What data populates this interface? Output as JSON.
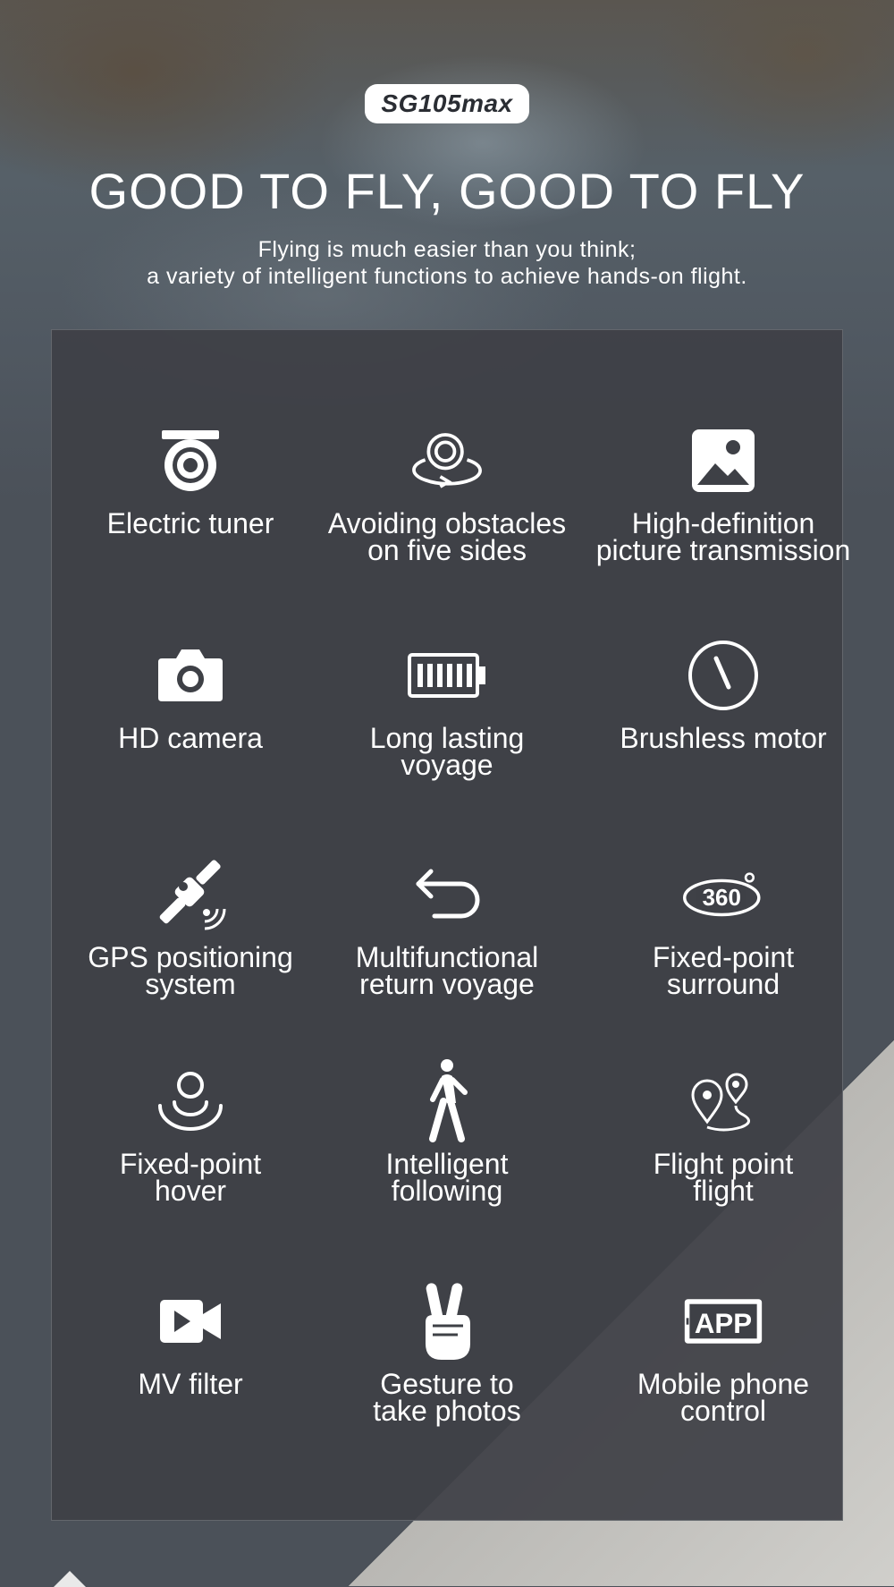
{
  "badge": "SG105max",
  "title": "GOOD TO FLY, GOOD TO FLY",
  "subtitle_line1": "Flying is much easier than you think;",
  "subtitle_line2": "a variety of intelligent functions to achieve hands-on flight.",
  "features": [
    {
      "icon": "electric-tuner-icon",
      "line1": "Electric tuner",
      "line2": ""
    },
    {
      "icon": "obstacle-avoidance-icon",
      "line1": "Avoiding obstacles",
      "line2": "on five sides"
    },
    {
      "icon": "picture-icon",
      "line1": "High-definition",
      "line2": "picture transmission"
    },
    {
      "icon": "camera-icon",
      "line1": "HD camera",
      "line2": ""
    },
    {
      "icon": "battery-icon",
      "line1": "Long lasting",
      "line2": "voyage"
    },
    {
      "icon": "gauge-icon",
      "line1": "Brushless motor",
      "line2": ""
    },
    {
      "icon": "satellite-icon",
      "line1": "GPS positioning",
      "line2": "system"
    },
    {
      "icon": "return-arrow-icon",
      "line1": "Multifunctional",
      "line2": "return voyage"
    },
    {
      "icon": "360-icon",
      "line1": "Fixed-point",
      "line2": "surround"
    },
    {
      "icon": "hover-icon",
      "line1": "Fixed-point",
      "line2": "hover"
    },
    {
      "icon": "walking-person-icon",
      "line1": "Intelligent",
      "line2": "following"
    },
    {
      "icon": "map-pins-icon",
      "line1": "Flight point",
      "line2": "flight"
    },
    {
      "icon": "video-icon",
      "line1": "MV filter",
      "line2": ""
    },
    {
      "icon": "victory-hand-icon",
      "line1": "Gesture to",
      "line2": "take photos"
    },
    {
      "icon": "app-icon",
      "line1": "Mobile phone",
      "line2": "control",
      "icon_text": "APP"
    }
  ]
}
